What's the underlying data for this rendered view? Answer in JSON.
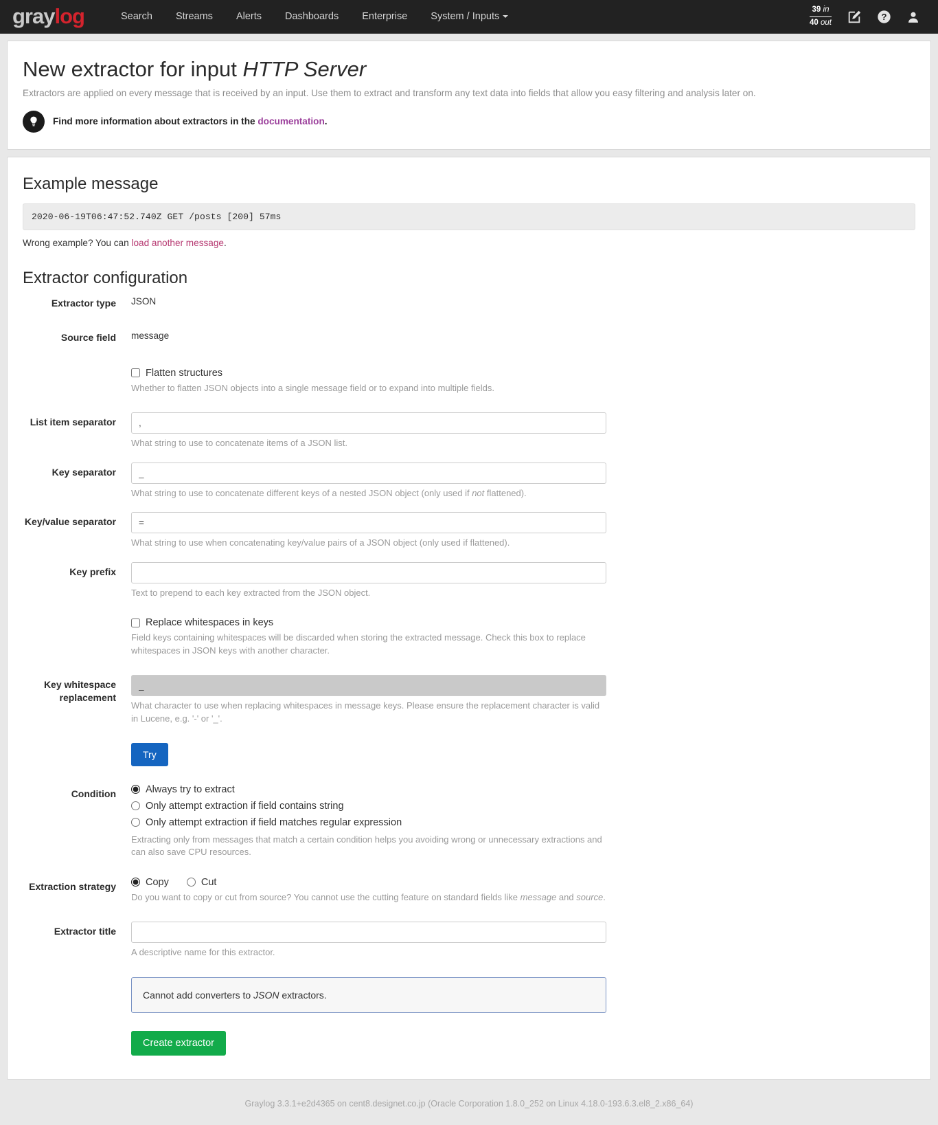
{
  "nav": {
    "brand_gray": "gray",
    "brand_red": "log",
    "links": [
      {
        "label": "Search"
      },
      {
        "label": "Streams"
      },
      {
        "label": "Alerts"
      },
      {
        "label": "Dashboards"
      },
      {
        "label": "Enterprise"
      },
      {
        "label": "System / Inputs",
        "caret": true
      }
    ],
    "throughput": {
      "in_value": "39",
      "in_label": "in",
      "out_value": "40",
      "out_label": "out"
    },
    "icons": [
      "edit-icon",
      "help-icon",
      "user-icon"
    ]
  },
  "header": {
    "title_prefix": "New extractor for input ",
    "title_input": "HTTP Server",
    "description": "Extractors are applied on every message that is received by an input. Use them to extract and transform any text data into fields that allow you easy filtering and analysis later on.",
    "hint_prefix": "Find more information about extractors in the ",
    "hint_link": "documentation",
    "hint_suffix": "."
  },
  "example": {
    "title": "Example message",
    "message": "2020-06-19T06:47:52.740Z GET /posts [200] 57ms",
    "wrong_prefix": "Wrong example? You can ",
    "wrong_link": "load another message",
    "wrong_suffix": "."
  },
  "config": {
    "title": "Extractor configuration",
    "extractor_type": {
      "label": "Extractor type",
      "value": "JSON"
    },
    "source_field": {
      "label": "Source field",
      "value": "message"
    },
    "flatten": {
      "label": "Flatten structures",
      "checked": false,
      "help": "Whether to flatten JSON objects into a single message field or to expand into multiple fields."
    },
    "list_item_separator": {
      "label": "List item separator",
      "value": ",",
      "help": "What string to use to concatenate items of a JSON list."
    },
    "key_separator": {
      "label": "Key separator",
      "value": "_",
      "help_1": "What string to use to concatenate different keys of a nested JSON object (only used if ",
      "help_ital": "not",
      "help_2": " flattened)."
    },
    "key_value_separator": {
      "label": "Key/value separator",
      "value": "=",
      "help": "What string to use when concatenating key/value pairs of a JSON object (only used if flattened)."
    },
    "key_prefix": {
      "label": "Key prefix",
      "value": "",
      "help": "Text to prepend to each key extracted from the JSON object."
    },
    "replace_whitespaces": {
      "label": "Replace whitespaces in keys",
      "checked": false,
      "help": "Field keys containing whitespaces will be discarded when storing the extracted message. Check this box to replace whitespaces in JSON keys with another character."
    },
    "key_whitespace_replacement": {
      "label": "Key whitespace replacement",
      "value": "_",
      "disabled": true,
      "help": "What character to use when replacing whitespaces in message keys. Please ensure the replacement character is valid in Lucene, e.g. '-' or '_'."
    },
    "try_button": "Try",
    "condition": {
      "label": "Condition",
      "options": [
        {
          "label": "Always try to extract",
          "selected": true
        },
        {
          "label": "Only attempt extraction if field contains string",
          "selected": false
        },
        {
          "label": "Only attempt extraction if field matches regular expression",
          "selected": false
        }
      ],
      "help": "Extracting only from messages that match a certain condition helps you avoiding wrong or unnecessary extractions and can also save CPU resources."
    },
    "extraction_strategy": {
      "label": "Extraction strategy",
      "options": [
        {
          "label": "Copy",
          "selected": true
        },
        {
          "label": "Cut",
          "selected": false
        }
      ],
      "help_1": "Do you want to copy or cut from source? You cannot use the cutting feature on standard fields like ",
      "help_ital_1": "message",
      "help_2": " and ",
      "help_ital_2": "source",
      "help_3": "."
    },
    "extractor_title": {
      "label": "Extractor title",
      "value": "",
      "help": "A descriptive name for this extractor."
    },
    "converters_alert_1": "Cannot add converters to ",
    "converters_alert_ital": "JSON",
    "converters_alert_2": " extractors.",
    "create_button": "Create extractor"
  },
  "footer": {
    "text": "Graylog 3.3.1+e2d4365 on cent8.designet.co.jp (Oracle Corporation 1.8.0_252 on Linux 4.18.0-193.6.3.el8_2.x86_64)"
  },
  "colors": {
    "navbar_bg": "#222222",
    "brand_red": "#d4232d",
    "try_button": "#1565c0",
    "create_button": "#12ab4a",
    "doc_link": "#9b3f9b",
    "message_link": "#b5366f"
  }
}
